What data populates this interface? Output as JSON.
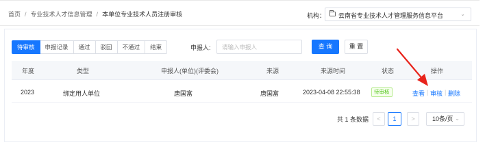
{
  "breadcrumb": {
    "home": "首页",
    "level1": "专业技术人才信息管理",
    "current": "本单位专业技术人员注册审核"
  },
  "org": {
    "label": "机构：",
    "value": "云南省专业技术人才管理服务信息平台"
  },
  "tabs": [
    "待审核",
    "申报记录",
    "通过",
    "驳回",
    "不通过",
    "结束"
  ],
  "active_tab": "待审核",
  "filter": {
    "applicant_label": "申报人:",
    "applicant_placeholder": "请输入申报人",
    "search_label": "查 询",
    "reset_label": "重 置"
  },
  "table": {
    "headers": [
      "年度",
      "类型",
      "申报人(单位)(评委会)",
      "来源",
      "来源时间",
      "状态",
      "操作"
    ],
    "rows": [
      {
        "year": "2023",
        "type": "绑定用人单位",
        "applicant": "唐国富",
        "source": "唐国富",
        "time": "2023-04-08 22:55:38",
        "status": "待审核",
        "actions": [
          "查看",
          "审核",
          "删除"
        ]
      }
    ]
  },
  "pagination": {
    "total_text": "共 1 条数据",
    "prev": "<",
    "current_page": "1",
    "next": ">",
    "page_size": "10条/页"
  },
  "colors": {
    "primary": "#1677ff",
    "annotation_arrow": "#e8231b",
    "status_green": "#52c41a"
  }
}
